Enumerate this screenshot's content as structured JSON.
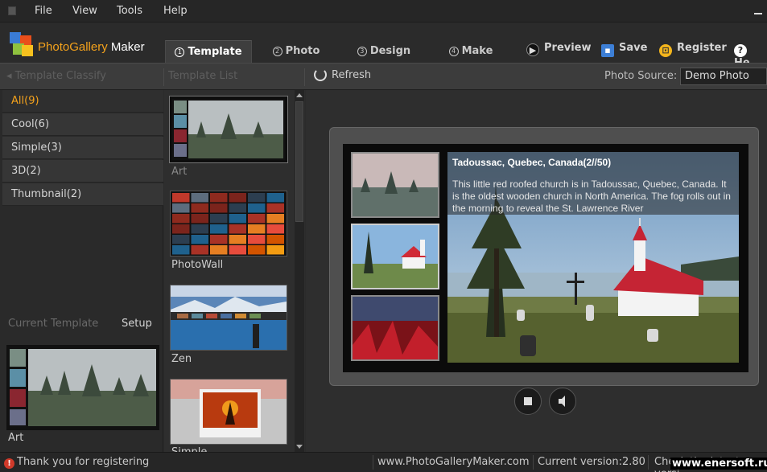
{
  "menu": {
    "file": "File",
    "view": "View",
    "tools": "Tools",
    "help": "Help"
  },
  "app": {
    "title_part1": "PhotoGallery",
    "title_part2": " Maker"
  },
  "tabs": [
    {
      "num": "1",
      "label": "Template"
    },
    {
      "num": "2",
      "label": "Photo"
    },
    {
      "num": "3",
      "label": "Design"
    },
    {
      "num": "4",
      "label": "Make"
    }
  ],
  "toolbar": {
    "preview": "Preview",
    "save": "Save",
    "register": "Register",
    "help": "He"
  },
  "subbar": {
    "classify": "Template Classify",
    "list": "Template List",
    "refresh": "Refresh",
    "source_label": "Photo Source:",
    "source_value": "Demo Photo"
  },
  "categories": [
    "All(9)",
    "Cool(6)",
    "Simple(3)",
    "3D(2)",
    "Thumbnail(2)"
  ],
  "current": {
    "label": "Current Template",
    "setup": "Setup",
    "name": "Art"
  },
  "templates": [
    "Art",
    "PhotoWall",
    "Zen",
    "Simple"
  ],
  "preview": {
    "caption_title": "Tadoussac, Quebec, Canada(2//50)",
    "caption_text": "This little red roofed church is in Tadoussac, Quebec, Canada. It is the oldest wooden church in North America. The fog rolls out in the morning to reveal the St. Lawrence River"
  },
  "status": {
    "message": "Thank you for registering",
    "site": "www.PhotoGalleryMaker.com",
    "version": "Current version:2.80",
    "check": "Check the latest versi",
    "watermark": "www.enersoft.ru"
  },
  "colors": {
    "accent": "#f4a21c",
    "background": "#2b2b2b"
  }
}
